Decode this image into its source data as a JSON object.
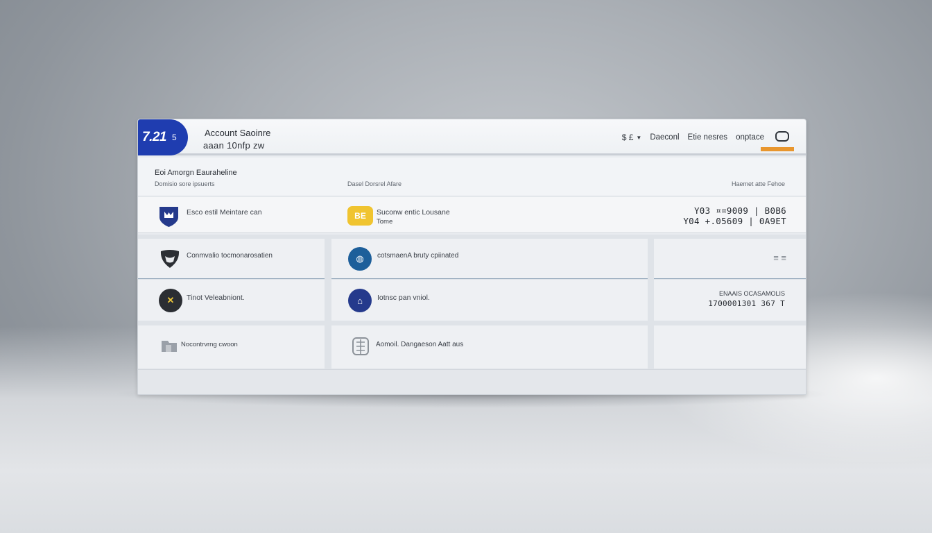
{
  "header": {
    "logo_main": "7.21",
    "logo_small": "5",
    "title": "Account Saoinre",
    "subtitle": "aaan 10nfp zw",
    "language": "$ £",
    "nav_items": [
      "Daeconl",
      "Etie nesres",
      "onptace"
    ]
  },
  "section": {
    "title": "Eoi Amorgn Eauraheline",
    "col_headers": [
      "Domisio sore ipsuerts",
      "Dasel Dorsrel Afare",
      "Haemet atte Fehoe"
    ]
  },
  "featured": {
    "left_label": "Esco estil Meintare can",
    "mid_label_line1": "Suconw entic Lousane",
    "mid_label_line2": "Tome",
    "card_text": "BE",
    "amount_line1": "Y03 ¤¤9009 | B0B6",
    "amount_line2": "Y04 +.05609 | 0A9ET"
  },
  "rows": [
    {
      "left_label": "Conmvalio tocmonarosatien",
      "mid_label": "cotsmaenA bruty cpiinated",
      "right_text": "≡ ≡"
    },
    {
      "left_label": "Tinot Veleabniont.",
      "mid_label": "Iotnsc pan vniol.",
      "right_line1": "ENAAIS OCASAMOLIS",
      "right_line2": "1700001301 367 T"
    },
    {
      "left_label": "Nocontrvrng cwoon",
      "mid_label": "Aomoil. Dangaeson Aatt aus"
    }
  ],
  "colors": {
    "brand_blue": "#1f3db0",
    "accent_orange": "#e8962e",
    "card_yellow": "#f0c430",
    "icon_navy": "#253a8c",
    "icon_teal_blue": "#1d5f9a"
  }
}
